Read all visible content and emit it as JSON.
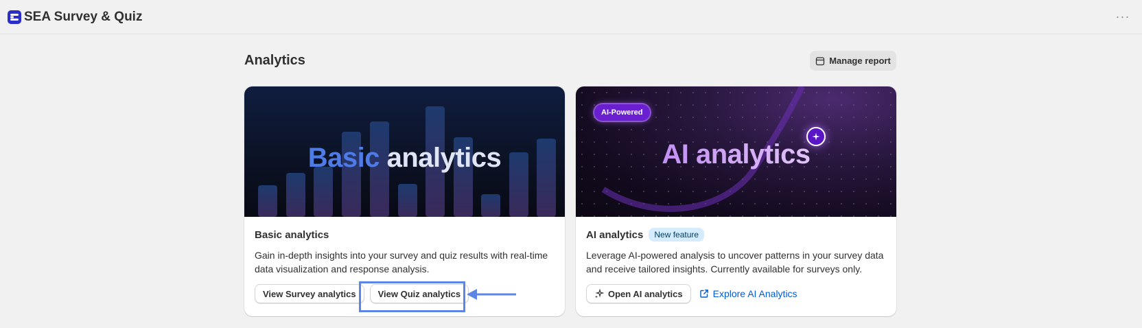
{
  "app": {
    "title": "SEA Survey & Quiz",
    "logo_icon": "app-logo-icon",
    "more_icon": "more-horizontal-icon",
    "more_label": "···"
  },
  "page": {
    "title": "Analytics",
    "manage_report_label": "Manage report",
    "manage_report_icon": "calendar-icon"
  },
  "cards": {
    "basic": {
      "banner_word1": "Basic",
      "banner_word2": "analytics",
      "title": "Basic analytics",
      "description": "Gain in-depth insights into your survey and quiz results with real-time data visualization and response analysis.",
      "survey_button_label": "View Survey analytics",
      "quiz_button_label": "View Quiz analytics"
    },
    "ai": {
      "pill_label": "AI-Powered",
      "banner_title": "AI analytics",
      "title": "AI analytics",
      "badge": "New feature",
      "description": "Leverage AI-powered analysis to uncover patterns in your survey data and receive tailored insights. Currently available for surveys only.",
      "open_button_label": "Open AI analytics",
      "open_button_icon": "sparkles-icon",
      "explore_link_label": "Explore AI Analytics",
      "explore_link_icon": "external-link-icon"
    }
  },
  "annotation": {
    "highlight_target": "View Quiz analytics",
    "color": "#5b86e5"
  },
  "colors": {
    "accent_link": "#005bd3",
    "ai_purple": "#6a1fd0",
    "badge_bg": "#d5ebff",
    "basic_blue": "#4e7be6"
  }
}
